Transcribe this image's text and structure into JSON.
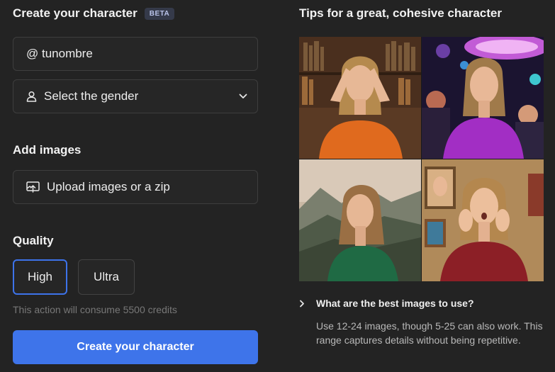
{
  "header": {
    "title": "Create your character",
    "badge": "BETA"
  },
  "form": {
    "username_value": "@ tunombre",
    "gender_placeholder": "Select the gender",
    "add_images_heading": "Add images",
    "upload_label": "Upload images or a zip",
    "quality_heading": "Quality",
    "quality_options": [
      {
        "label": "High",
        "selected": true
      },
      {
        "label": "Ultra",
        "selected": false
      }
    ],
    "credits_note": "This action will consume 5500 credits",
    "submit_label": "Create your character"
  },
  "tips": {
    "title": "Tips for a great, cohesive character",
    "question": "What are the best images to use?",
    "answer": "Use 12-24 images, though 5-25 can also work. This range captures details without being repetitive."
  },
  "icons": {
    "gender": "person-icon",
    "dropdown": "chevron-down-icon",
    "upload": "upload-icon",
    "faq_toggle": "chevron-right-icon"
  },
  "colors": {
    "background": "#232323",
    "accent": "#3e74ea",
    "field_border": "#3e3e3e"
  }
}
